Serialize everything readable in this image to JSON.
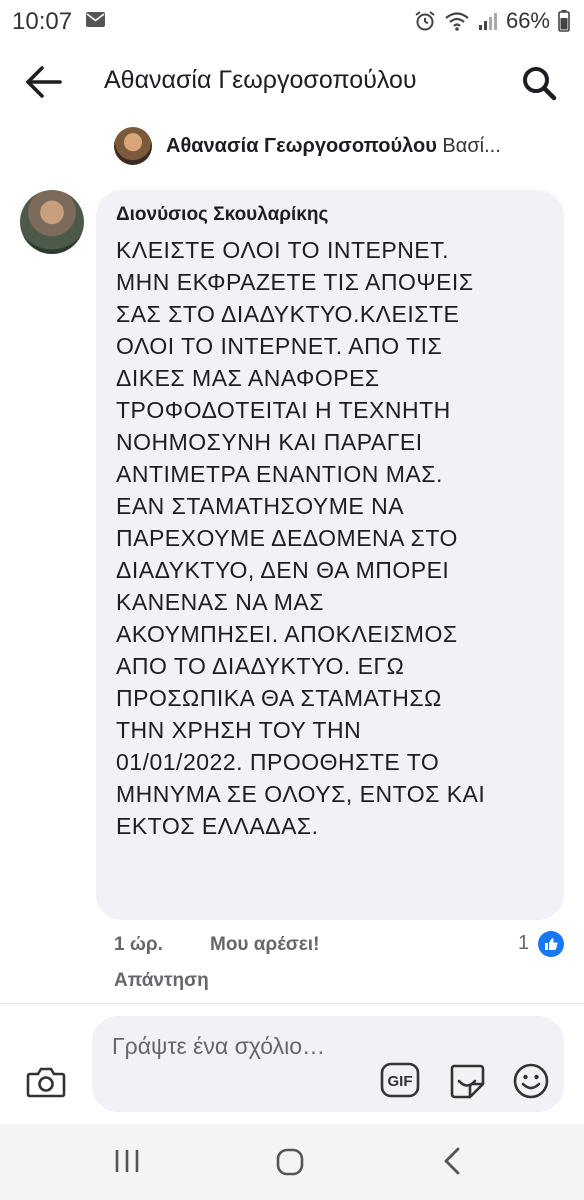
{
  "status_bar": {
    "time": "10:07",
    "battery": "66%"
  },
  "header": {
    "title": "Αθανασία Γεωργοσοπούλου"
  },
  "context": {
    "name": "Αθανασία Γεωργοσοπούλου",
    "extra": " Βασί..."
  },
  "comment": {
    "author": "Διονύσιος Σκουλαρίκης",
    "lines": [
      "ΚΛΕΙΣΤΕ ΟΛΟΙ ΤΟ ΙΝΤΕΡΝΕΤ.",
      "ΜΗΝ ΕΚΦΡΑΖΕΤΕ ΤΙΣ ΑΠΟΨΕΙΣ",
      "ΣΑΣ ΣΤΟ ΔΙΑΔΥΚΤΥΟ.ΚΛΕΙΣΤΕ",
      "ΟΛΟΙ ΤΟ ΙΝΤΕΡΝΕΤ. ΑΠΟ ΤΙΣ",
      "ΔΙΚΕΣ ΜΑΣ ΑΝΑΦΟΡΕΣ",
      "ΤΡΟΦΟΔΟΤΕΙΤΑΙ Η ΤΕΧΝΗΤΗ",
      "ΝΟΗΜΟΣΥΝΗ ΚΑΙ ΠΑΡΑΓΕΙ",
      "ΑΝΤΙΜΕΤΡΑ ΕΝΑΝΤΙΟΝ ΜΑΣ.",
      "ΕΑΝ ΣΤΑΜΑΤΗΣΟΥΜΕ ΝΑ",
      "ΠΑΡΕΧΟΥΜΕ ΔΕΔΟΜΕΝΑ ΣΤΟ",
      "ΔΙΑΔΥΚΤΥΟ, ΔΕΝ ΘΑ ΜΠΟΡΕΙ",
      "ΚΑΝΕΝΑΣ ΝΑ ΜΑΣ",
      "ΑΚΟΥΜΠΗΣΕΙ. ΑΠΟΚΛΕΙΣΜΟΣ",
      "ΑΠΟ ΤΟ ΔΙΑΔΥΚΤΥΟ. ΕΓΩ",
      "ΠΡΟΣΩΠΙΚΑ ΘΑ ΣΤΑΜΑΤΗΣΩ",
      "ΤΗΝ ΧΡΗΣΗ ΤΟΥ ΤΗΝ",
      "01/01/2022. ΠΡΟΟΘΗΣΤΕ ΤΟ",
      "ΜΗΝΥΜΑ ΣΕ ΟΛΟΥΣ, ΕΝΤΟΣ ΚΑΙ",
      "ΕΚΤΟΣ ΕΛΛΑΔΑΣ."
    ],
    "time": "1 ώρ.",
    "like_label": "Μου αρέσει!",
    "like_count": "1",
    "reply_label": "Απάντηση"
  },
  "composer": {
    "placeholder": "Γράψτε ένα σχόλιο…",
    "gif_label": "GIF"
  },
  "colors": {
    "accent": "#1877f2",
    "bubble": "#f0f2f5",
    "secondary_text": "#65676b"
  }
}
